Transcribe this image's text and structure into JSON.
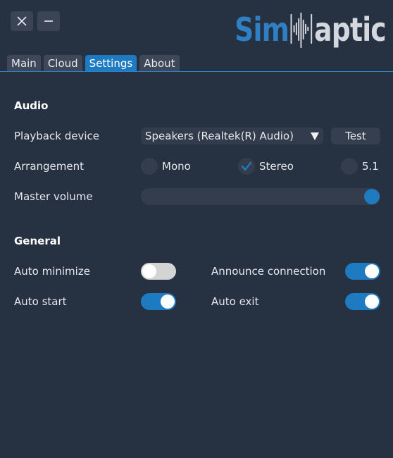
{
  "logo": {
    "part1": "Sim",
    "part2": "aptic"
  },
  "tabs": [
    {
      "label": "Main",
      "active": false
    },
    {
      "label": "Cloud",
      "active": false
    },
    {
      "label": "Settings",
      "active": true
    },
    {
      "label": "About",
      "active": false
    }
  ],
  "audio": {
    "title": "Audio",
    "playback_label": "Playback device",
    "playback_value": "Speakers (Realtek(R) Audio)",
    "test_label": "Test",
    "arrangement_label": "Arrangement",
    "options": [
      {
        "label": "Mono",
        "checked": false
      },
      {
        "label": "Stereo",
        "checked": true
      },
      {
        "label": "5.1",
        "checked": false
      }
    ],
    "master_volume_label": "Master volume",
    "master_volume_level": 1.0
  },
  "general": {
    "title": "General",
    "auto_minimize_label": "Auto minimize",
    "auto_minimize": false,
    "announce_label": "Announce connection",
    "announce": true,
    "auto_start_label": "Auto start",
    "auto_start": true,
    "auto_exit_label": "Auto exit",
    "auto_exit": true
  },
  "colors": {
    "background": "#263142",
    "accent": "#1f7bc1"
  }
}
